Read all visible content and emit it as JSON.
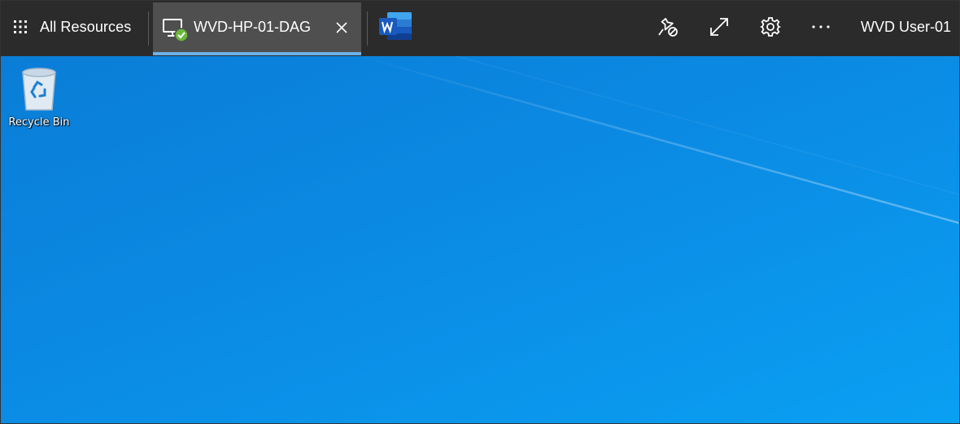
{
  "topbar": {
    "all_resources_label": "All Resources",
    "tab": {
      "label": "WVD-HP-01-DAG",
      "status": "connected"
    },
    "user_label": "WVD User-01"
  },
  "desktop": {
    "icons": [
      {
        "label": "Recycle Bin"
      }
    ]
  },
  "colors": {
    "topbar": "#2b2b2b",
    "active_tab": "#4f4f4f",
    "tab_underline": "#6cb0e8",
    "desktop": "#0a8fe8",
    "status_ok": "#6bb83a"
  }
}
